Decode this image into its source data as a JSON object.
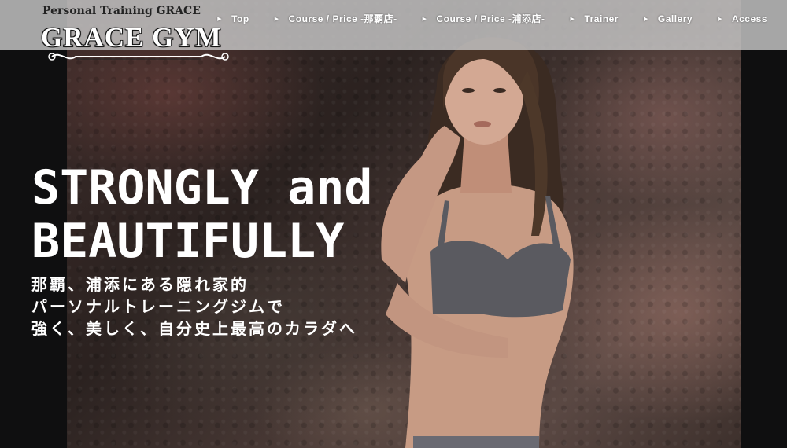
{
  "logo": {
    "tagline": "Personal Training GRACE",
    "name": "GRACE GYM"
  },
  "nav": {
    "items": [
      {
        "label": "Top"
      },
      {
        "label": "Course / Price -那覇店-"
      },
      {
        "label": "Course / Price -浦添店-"
      },
      {
        "label": "Trainer"
      },
      {
        "label": "Gallery"
      },
      {
        "label": "Access"
      }
    ]
  },
  "hero": {
    "headline_line1": "STRONGLY and",
    "headline_line2": "BEAUTIFULLY",
    "sub_line1": "那覇、浦添にある隠れ家的",
    "sub_line2": "パーソナルトレーニングジムで",
    "sub_line3": "強く、美しく、自分史上最高のカラダへ"
  },
  "colors": {
    "topbar": "#c8c8c8",
    "side": "#0f0f10",
    "text": "#ffffff"
  }
}
